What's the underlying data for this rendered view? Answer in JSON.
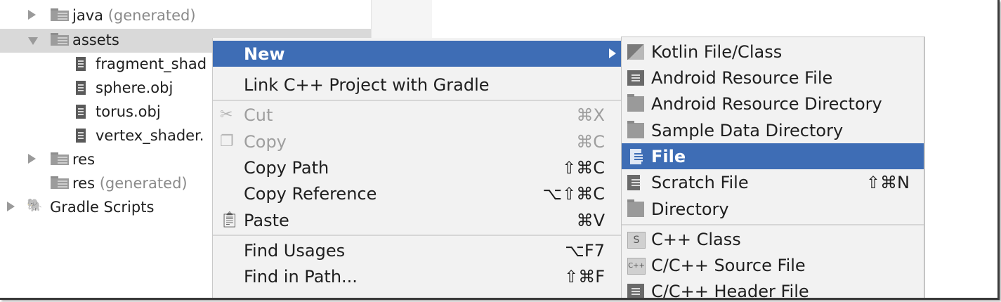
{
  "tree": {
    "items": [
      {
        "label": "java",
        "suffix": "(generated)",
        "icon": "generated-folder-icon"
      },
      {
        "label": "assets",
        "suffix": "",
        "icon": "folder-icon"
      },
      {
        "label": "fragment_shad",
        "suffix": "",
        "icon": "file-icon"
      },
      {
        "label": "sphere.obj",
        "suffix": "",
        "icon": "file-icon"
      },
      {
        "label": "torus.obj",
        "suffix": "",
        "icon": "file-icon"
      },
      {
        "label": "vertex_shader.",
        "suffix": "",
        "icon": "file-icon"
      },
      {
        "label": "res",
        "suffix": "",
        "icon": "folder-icon"
      },
      {
        "label": "res",
        "suffix": "(generated)",
        "icon": "folder-icon"
      },
      {
        "label": "Gradle Scripts",
        "suffix": "",
        "icon": "gradle-icon"
      }
    ]
  },
  "context_menu": {
    "items": [
      {
        "label": "New",
        "shortcut": "",
        "icon": ""
      },
      {
        "label": "Link C++ Project with Gradle",
        "shortcut": "",
        "icon": ""
      },
      {
        "label": "Cut",
        "shortcut": "⌘X",
        "icon": "scissors-icon"
      },
      {
        "label": "Copy",
        "shortcut": "⌘C",
        "icon": "copy-icon"
      },
      {
        "label": "Copy Path",
        "shortcut": "⇧⌘C",
        "icon": ""
      },
      {
        "label": "Copy Reference",
        "shortcut": "⌥⇧⌘C",
        "icon": ""
      },
      {
        "label": "Paste",
        "shortcut": "⌘V",
        "icon": "clipboard-icon"
      },
      {
        "label": "Find Usages",
        "shortcut": "⌥F7",
        "icon": ""
      },
      {
        "label": "Find in Path...",
        "shortcut": "⇧⌘F",
        "icon": ""
      }
    ]
  },
  "new_submenu": {
    "items": [
      {
        "label": "Kotlin File/Class",
        "shortcut": "",
        "icon": "kotlin-icon"
      },
      {
        "label": "Android Resource File",
        "shortcut": "",
        "icon": "android-resource-file-icon"
      },
      {
        "label": "Android Resource Directory",
        "shortcut": "",
        "icon": "folder-icon"
      },
      {
        "label": "Sample Data Directory",
        "shortcut": "",
        "icon": "folder-icon"
      },
      {
        "label": "File",
        "shortcut": "",
        "icon": "file-icon"
      },
      {
        "label": "Scratch File",
        "shortcut": "⇧⌘N",
        "icon": "scratch-file-icon"
      },
      {
        "label": "Directory",
        "shortcut": "",
        "icon": "folder-icon"
      },
      {
        "label": "C++ Class",
        "shortcut": "",
        "icon": "cpp-class-icon",
        "badge": "S"
      },
      {
        "label": "C/C++ Source File",
        "shortcut": "",
        "icon": "cpp-source-icon",
        "badge": "C++"
      },
      {
        "label": "C/C++ Header File",
        "shortcut": "",
        "icon": "cpp-header-icon"
      }
    ]
  }
}
